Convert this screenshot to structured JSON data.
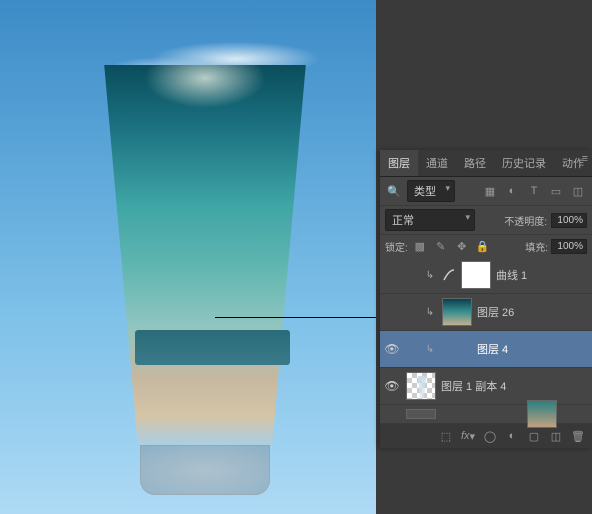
{
  "panel": {
    "tabs": [
      "图层",
      "通道",
      "路径",
      "历史记录",
      "动作"
    ],
    "active_tab": "图层",
    "kind_label": "类型",
    "blend_mode": "正常",
    "opacity_label": "不透明度:",
    "opacity_value": "100%",
    "lock_label": "锁定:",
    "fill_label": "填充:",
    "fill_value": "100%"
  },
  "layers": [
    {
      "name": "曲线 1",
      "visible": false,
      "selected": false,
      "indent": 1,
      "link": true,
      "thumb": "white",
      "adjustment": true
    },
    {
      "name": "图层 26",
      "visible": false,
      "selected": false,
      "indent": 1,
      "link": true,
      "thumb": "sky"
    },
    {
      "name": "图层 4",
      "visible": true,
      "selected": true,
      "indent": 1,
      "link": true,
      "thumb": "glass"
    },
    {
      "name": "图层 1 副本 4",
      "visible": true,
      "selected": false,
      "indent": 0,
      "link": false,
      "thumb": "checker"
    }
  ]
}
